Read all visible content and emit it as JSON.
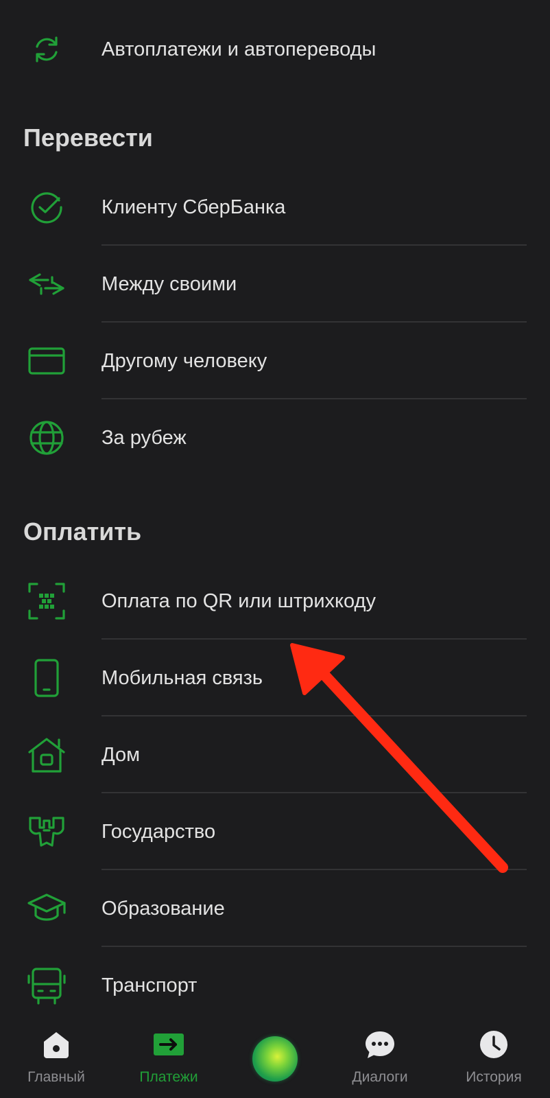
{
  "colors": {
    "background": "#1c1c1e",
    "accent": "#21a038",
    "icon_green": "#21a038",
    "annotation_arrow": "#ff2a12",
    "nav_inactive": "#8e8e92"
  },
  "top_item": {
    "label": "Автоплатежи и автопереводы",
    "icon": "refresh-icon"
  },
  "transfer_section": {
    "title": "Перевести",
    "items": [
      {
        "label": "Клиенту СберБанка",
        "icon": "sber-check-icon"
      },
      {
        "label": "Между своими",
        "icon": "swap-arrows-icon"
      },
      {
        "label": "Другому человеку",
        "icon": "card-icon"
      },
      {
        "label": "За рубеж",
        "icon": "globe-icon"
      }
    ]
  },
  "pay_section": {
    "title": "Оплатить",
    "items": [
      {
        "label": "Оплата по QR или штрихкоду",
        "icon": "qr-scan-icon"
      },
      {
        "label": "Мобильная связь",
        "icon": "phone-icon"
      },
      {
        "label": "Дом",
        "icon": "house-icon"
      },
      {
        "label": "Государство",
        "icon": "coat-of-arms-icon"
      },
      {
        "label": "Образование",
        "icon": "graduation-cap-icon"
      },
      {
        "label": "Транспорт",
        "icon": "bus-icon"
      }
    ]
  },
  "bottom_nav": {
    "items": [
      {
        "label": "Главный",
        "icon": "home-icon",
        "active": false
      },
      {
        "label": "Платежи",
        "icon": "payments-arrow-icon",
        "active": true
      },
      {
        "label": "",
        "icon": "assistant-orb-icon",
        "active": false
      },
      {
        "label": "Диалоги",
        "icon": "chat-bubble-icon",
        "active": false
      },
      {
        "label": "История",
        "icon": "clock-icon",
        "active": false
      }
    ]
  }
}
